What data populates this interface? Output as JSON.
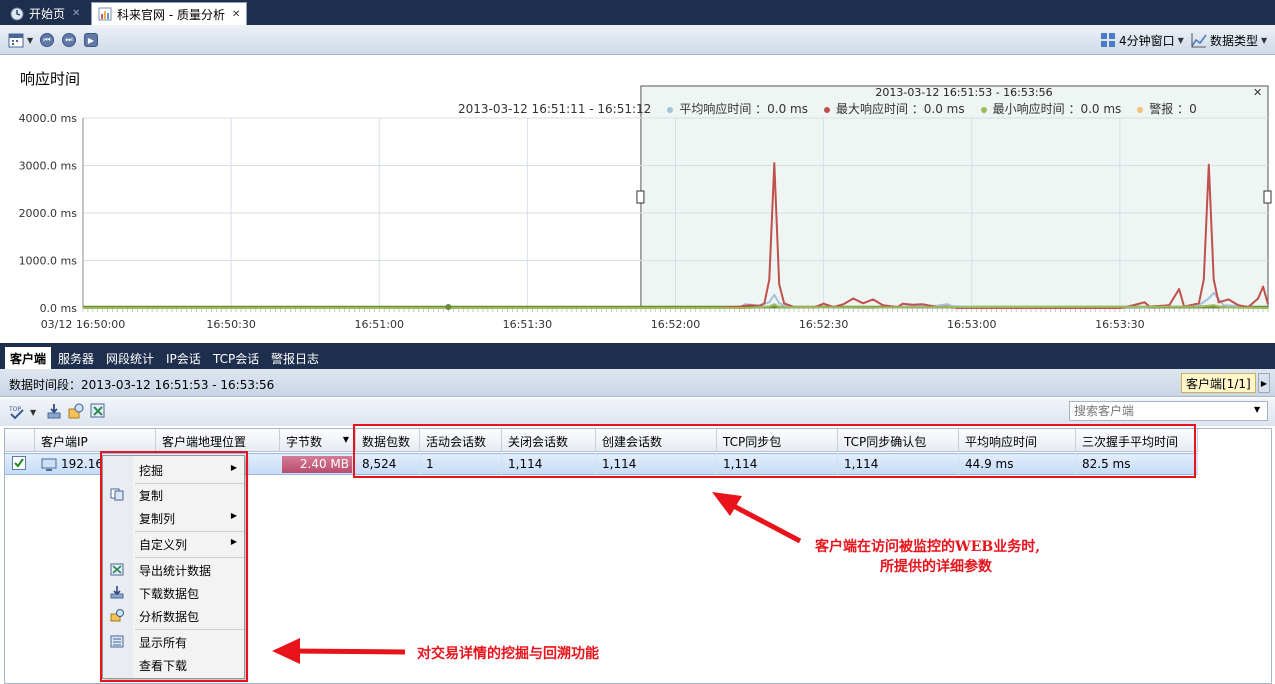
{
  "tabs": [
    {
      "label": "开始页",
      "icon": "home-icon"
    },
    {
      "label": "科来官网 - 质量分析",
      "icon": "chart-doc-icon"
    }
  ],
  "toolbar": {
    "window_label": "4分钟窗口",
    "data_type_label": "数据类型"
  },
  "chart": {
    "title": "响应时间",
    "range_label": "2013-03-12  16:51:11 - 16:51:12",
    "legend": [
      {
        "label": "平均响应时间 ：0.0 ms",
        "color": "#a9c0dd"
      },
      {
        "label": "最大响应时间 ：0.0 ms",
        "color": "#c0504d"
      },
      {
        "label": "最小响应时间 ：0.0 ms",
        "color": "#9bbb59"
      },
      {
        "label": "警报 ：0",
        "color": "#f2c17a"
      }
    ],
    "selection_label": "2013-03-12  16:51:53 - 16:53:56"
  },
  "chart_data": {
    "type": "line",
    "title": "响应时间",
    "y_tick_labels": [
      "4000.0 ms",
      "3000.0 ms",
      "2000.0 ms",
      "1000.0 ms",
      "0.0 ms"
    ],
    "x_tick_labels": [
      "03/12 16:50:00",
      "16:50:30",
      "16:51:00",
      "16:51:30",
      "16:52:00",
      "16:52:30",
      "16:53:00",
      "16:53:30"
    ],
    "ylim": [
      0,
      4000
    ],
    "x_seconds_range": [
      0,
      240
    ],
    "series": [
      {
        "name": "平均响应时间",
        "color": "#a9c0dd",
        "points": [
          [
            128,
            0
          ],
          [
            133,
            0
          ],
          [
            134,
            80
          ],
          [
            137,
            60
          ],
          [
            139,
            120
          ],
          [
            140,
            280
          ],
          [
            141,
            100
          ],
          [
            143,
            20
          ],
          [
            160,
            0
          ],
          [
            165,
            30
          ],
          [
            173,
            50
          ],
          [
            175,
            80
          ],
          [
            176,
            40
          ],
          [
            187,
            0
          ],
          [
            214,
            0
          ],
          [
            217,
            40
          ],
          [
            222,
            30
          ],
          [
            226,
            60
          ],
          [
            228,
            200
          ],
          [
            229,
            320
          ],
          [
            231,
            60
          ],
          [
            235,
            40
          ],
          [
            237,
            0
          ],
          [
            240,
            0
          ]
        ]
      },
      {
        "name": "最大响应时间",
        "color": "#c0504d",
        "points": [
          [
            0,
            0
          ],
          [
            128,
            0
          ],
          [
            133,
            30
          ],
          [
            135,
            60
          ],
          [
            137,
            40
          ],
          [
            138,
            100
          ],
          [
            139,
            600
          ],
          [
            140,
            3050
          ],
          [
            141,
            500
          ],
          [
            142,
            100
          ],
          [
            144,
            20
          ],
          [
            148,
            10
          ],
          [
            150,
            90
          ],
          [
            152,
            20
          ],
          [
            154,
            80
          ],
          [
            156,
            200
          ],
          [
            158,
            100
          ],
          [
            160,
            180
          ],
          [
            162,
            60
          ],
          [
            165,
            20
          ],
          [
            166,
            90
          ],
          [
            168,
            70
          ],
          [
            170,
            80
          ],
          [
            173,
            20
          ],
          [
            175,
            30
          ],
          [
            177,
            0
          ],
          [
            210,
            0
          ],
          [
            212,
            40
          ],
          [
            215,
            120
          ],
          [
            216,
            30
          ],
          [
            220,
            60
          ],
          [
            222,
            400
          ],
          [
            223,
            30
          ],
          [
            226,
            100
          ],
          [
            227,
            600
          ],
          [
            228,
            3020
          ],
          [
            229,
            600
          ],
          [
            230,
            120
          ],
          [
            232,
            180
          ],
          [
            234,
            60
          ],
          [
            236,
            20
          ],
          [
            238,
            200
          ],
          [
            239,
            450
          ],
          [
            240,
            80
          ]
        ]
      },
      {
        "name": "最小响应时间",
        "color": "#9bbb59",
        "points": [
          [
            0,
            0
          ],
          [
            135,
            0
          ],
          [
            137,
            20
          ],
          [
            139,
            30
          ],
          [
            140,
            80
          ],
          [
            141,
            20
          ],
          [
            160,
            10
          ],
          [
            175,
            20
          ],
          [
            226,
            30
          ],
          [
            229,
            60
          ],
          [
            231,
            10
          ],
          [
            240,
            0
          ]
        ]
      }
    ],
    "alarm_points": [
      [
        74,
        0
      ]
    ],
    "selection_window_seconds": [
      113,
      236
    ]
  },
  "panel_tabs": [
    "客户端",
    "服务器",
    "网段统计",
    "IP会话",
    "TCP会话",
    "警报日志"
  ],
  "period": {
    "text": "数据时间段：2013-03-12  16:51:53 - 16:53:56",
    "client_badge": "客户端[1/1]"
  },
  "search": {
    "placeholder": "搜索客户端"
  },
  "table": {
    "headers": [
      "客户端IP",
      "客户端地理位置",
      "字节数",
      "数据包数",
      "活动会话数",
      "关闭会话数",
      "创建会话数",
      "TCP同步包",
      "TCP同步确认包",
      "平均响应时间",
      "三次握手平均时间"
    ],
    "row": {
      "ip": "192.16",
      "bytes": "2.40 MB",
      "bytes_fraction": 1.0,
      "packets": "8,524",
      "active": "1",
      "closed": "1,114",
      "created": "1,114",
      "syn": "1,114",
      "synack": "1,114",
      "avg_resp": "44.9 ms",
      "handshake": "82.5 ms"
    }
  },
  "context_menu": [
    {
      "label": "挖掘",
      "submenu": true
    },
    {
      "label": "复制",
      "icon": "copy-icon"
    },
    {
      "label": "复制列",
      "submenu": true
    },
    {
      "label": "自定义列",
      "submenu": true
    },
    {
      "label": "导出统计数据",
      "icon": "export-icon"
    },
    {
      "label": "下载数据包",
      "icon": "download-icon"
    },
    {
      "label": "分析数据包",
      "icon": "analyze-icon"
    },
    {
      "label": "显示所有",
      "icon": "show-all-icon"
    },
    {
      "label": "查看下载"
    }
  ],
  "annotations": {
    "right_line1": "客户端在访问被监控的WEB业务时,",
    "right_line2": "所提供的详细参数",
    "bottom": "对交易详情的挖掘与回溯功能",
    "color": "#e8131b"
  }
}
